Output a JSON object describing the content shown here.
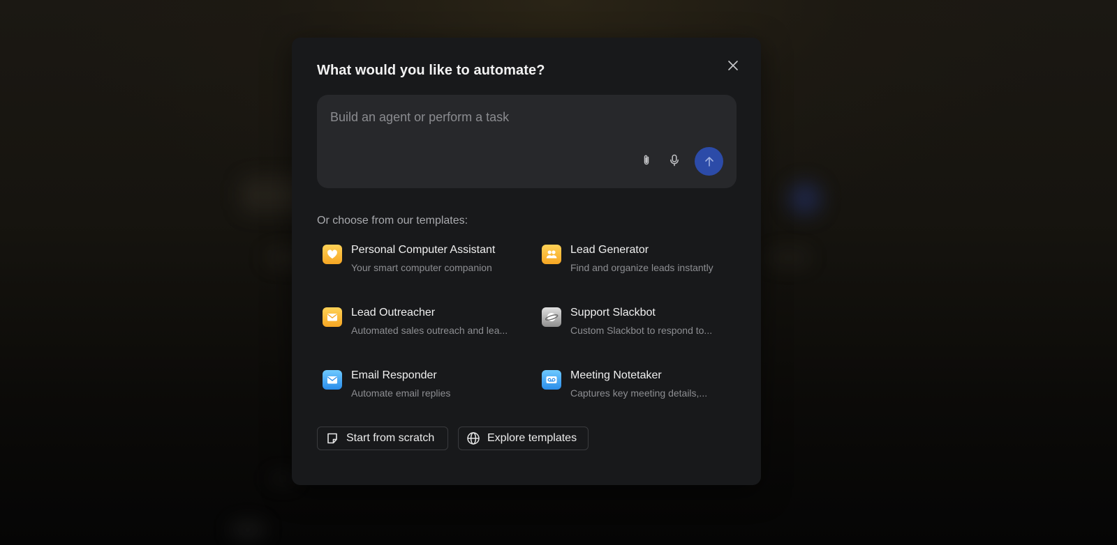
{
  "modal": {
    "title": "What would you like to automate?",
    "close_icon": "close-icon"
  },
  "prompt": {
    "placeholder": "Build an agent or perform a task",
    "value": "",
    "attach_icon": "paperclip-icon",
    "mic_icon": "microphone-icon",
    "send_icon": "arrow-up-icon"
  },
  "templates": {
    "label": "Or choose from our templates:",
    "items": [
      {
        "title": "Personal Computer Assistant",
        "description": "Your smart computer companion",
        "icon": "heart-icon",
        "color": "yellow"
      },
      {
        "title": "Lead Generator",
        "description": "Find and organize leads instantly",
        "icon": "people-icon",
        "color": "yellow"
      },
      {
        "title": "Lead Outreacher",
        "description": "Automated sales outreach and lea...",
        "icon": "envelope-icon",
        "color": "yellow"
      },
      {
        "title": "Support Slackbot",
        "description": "Custom Slackbot to respond to...",
        "icon": "planet-icon",
        "color": "gray"
      },
      {
        "title": "Email Responder",
        "description": "Automate email replies",
        "icon": "mail-icon",
        "color": "blue"
      },
      {
        "title": "Meeting Notetaker",
        "description": "Captures key meeting details,...",
        "icon": "voicemail-icon",
        "color": "blue"
      }
    ]
  },
  "footer": {
    "scratch_label": "Start from scratch",
    "scratch_icon": "note-icon",
    "explore_label": "Explore templates",
    "explore_icon": "globe-icon"
  },
  "colors": {
    "modal_bg": "#18191b",
    "input_bg": "#27282b",
    "send_button": "#2c4ba8",
    "icon_yellow": "#f6a623",
    "icon_blue": "#2a8dea"
  }
}
